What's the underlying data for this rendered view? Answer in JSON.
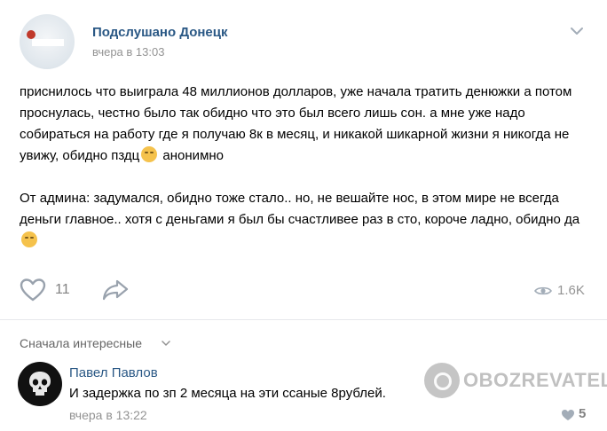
{
  "post": {
    "group_name": "Подслушано Донецк",
    "time": "вчера в 13:03",
    "paragraph1": "приснилось что выиграла 48 миллионов долларов, уже начала тратить денюжки а потом проснулась, честно было так обидно что это был всего лишь сон. а мне уже надо собираться на работу где я получаю 8к в месяц, и никакой шикарной жизни я никогда не увижу, обидно пздц",
    "paragraph1_tail": " анонимно",
    "paragraph2": "От админа: задумался, обидно тоже стало.. но, не вешайте нос, в этом мире не всегда деньги главное.. хотя с деньгами я был бы счастливее раз в сто, короче ладно, обидно да ",
    "likes": "11",
    "views": "1.6K"
  },
  "comments_section": {
    "sort_label": "Сначала интересные"
  },
  "comment": {
    "author": "Павел Павлов",
    "text": "И задержка по зп 2 месяца на эти ссаные 8рублей.",
    "time": "вчера в 13:22",
    "likes": "5"
  },
  "watermark": {
    "text": "OBOZREVATEL"
  },
  "icons": {
    "like": "heart-icon",
    "share": "share-arrow-icon",
    "views": "eye-icon",
    "more": "chevron-down-icon",
    "sort": "chevron-down-icon"
  },
  "colors": {
    "link": "#2a5885",
    "muted": "#939393"
  }
}
